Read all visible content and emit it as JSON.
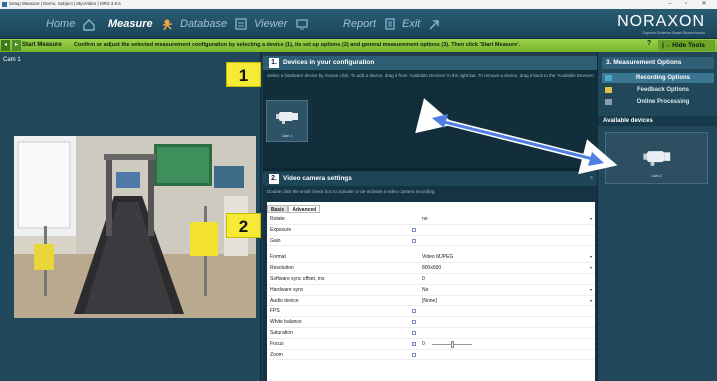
{
  "window": {
    "title": "Setup Measure | Demo, Subject | MyoVideo | MR3 3.8.6",
    "minimize": "–",
    "maximize": "▫",
    "close": "✕"
  },
  "nav": {
    "items": [
      {
        "label": "Home"
      },
      {
        "label": "Measure"
      },
      {
        "label": "Database"
      },
      {
        "label": "Viewer"
      },
      {
        "label": "Report"
      },
      {
        "label": "Exit"
      }
    ],
    "logo_name": "NORAXON",
    "logo_tagline": "Superior Evidence-Based Biomechanics"
  },
  "toolbar": {
    "start_label": "Start Measure",
    "instruction": "Confirm or adjust the selected measurement configuration by selecting a device (1), its set up options (2) and general measurement options (3). Then click 'Start Measure'.",
    "help": "?",
    "hide_tools": "Hide Tools"
  },
  "left": {
    "cam_label": "Cam 1"
  },
  "badges": {
    "one": "1",
    "two": "2"
  },
  "devices": {
    "num": "1.",
    "title": "Devices in your configuration",
    "description": "Select a hardware device by mouse click. To add a device, drag it from 'Available Devices' in the right bar. To remove a device, drag it back to the 'Available Devices'.",
    "card_name": "Cam 1"
  },
  "camera_settings": {
    "num": "2.",
    "title": "Video camera settings",
    "description": "Double click the small check box to activate or de-activate a video camera recording.",
    "tabs": [
      "Basic",
      "Advanced"
    ],
    "rows": [
      {
        "label": "Rotate",
        "value": "no",
        "dropdown": "▾"
      },
      {
        "label": "Exposure",
        "value": ""
      },
      {
        "label": "Gain",
        "value": ""
      },
      {
        "label": "Format",
        "value": "Video MJPEG",
        "dropdown": "▾"
      },
      {
        "label": "Resolution",
        "value": "800x600",
        "dropdown": "▾"
      },
      {
        "label": "Software sync offset, ms",
        "value": "0"
      },
      {
        "label": "Hardware sync",
        "value": "No",
        "dropdown": "▾"
      },
      {
        "label": "Audio device",
        "value": "[None]",
        "dropdown": "▾"
      },
      {
        "label": "FPS",
        "value": ""
      },
      {
        "label": "White balance",
        "value": ""
      },
      {
        "label": "Saturation",
        "value": ""
      },
      {
        "label": "Focus",
        "value": "0"
      },
      {
        "label": "Zoom",
        "value": ""
      }
    ]
  },
  "measurement_options": {
    "num": "3.",
    "title": "Measurement Options",
    "items": [
      "Recording Options",
      "Feedback Options",
      "Online Processing"
    ]
  },
  "available": {
    "title": "Available devices",
    "card_name": "Cam 2"
  },
  "colors": {
    "toolbar_green": "#8cc63f",
    "badge_yellow": "#f5ea35",
    "arrow_blue": "#4f7fe0"
  }
}
